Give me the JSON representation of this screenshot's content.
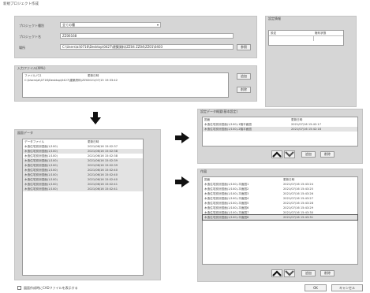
{
  "window": {
    "title": "新規プロジェクト作成"
  },
  "project": {
    "type_label": "プロジェクト種別",
    "type_value": "全ての種",
    "name_label": "プロジェクト名",
    "name_value": "ZZ06168",
    "folder_label": "場所",
    "folder_value": "C:\\Users\\ai\\0716\\Desktop\\0427\\建築資料\\ZZ04 ZZ04\\ZZ01\\0403",
    "browse_label": "参照"
  },
  "side_panel": {
    "title": "設定情報",
    "col1": "設定",
    "col2": "権利状態"
  },
  "input_file": {
    "title": "入力ファイル(XML)",
    "col1": "ファイルパス",
    "col2": "更新日時",
    "path": "C:\\Users\\ai\\0716\\Desktop\\0427\\建築資料\\ZZ04 ZZ04\\ZZ01\\0403",
    "date": "2021/07/15 19:33:42",
    "add_label": "追加",
    "delete_label": "削除"
  },
  "source_list": {
    "title": "図面データ",
    "col1": "データファイル",
    "col2": "更新日時",
    "rows": [
      {
        "name": "木造住宅設計図面(1/100)",
        "date": "2021/06/16 15:02:37"
      },
      {
        "name": "木造住宅設計図面(1/100)",
        "date": "2021/06/16 15:02:38"
      },
      {
        "name": "木造住宅設計図面(1/100)",
        "date": "2021/06/16 15:02:38"
      },
      {
        "name": "木造住宅設計図面(1/100)",
        "date": "2021/06/16 15:02:39"
      },
      {
        "name": "木造住宅設計図面(1/100)",
        "date": "2021/06/16 15:02:39"
      },
      {
        "name": "木造住宅設計図面(1/100)",
        "date": "2021/06/16 15:02:40"
      },
      {
        "name": "木造住宅設計図面(1/100)",
        "date": "2021/06/16 15:02:40"
      },
      {
        "name": "木造住宅設計図面(1/100)",
        "date": "2021/06/16 15:02:40"
      },
      {
        "name": "木造住宅設計図面(1/100)",
        "date": "2021/06/16 15:02:41"
      },
      {
        "name": "木造住宅設計図面(1/100)",
        "date": "2021/06/16 15:02:41"
      }
    ]
  },
  "target1": {
    "title": "設定データ概要(基本設定)",
    "col1": "図面",
    "col2": "更新日時",
    "rows": [
      {
        "name": "木造住宅設計図面(1/100)-1階平面図",
        "date": "2021/07/16 15:42:17"
      },
      {
        "name": "木造住宅設計図面(1/100)-2階平面図",
        "date": "2021/07/16 15:42:18"
      }
    ],
    "up_label": "上へ",
    "down_label": "下へ",
    "add_label": "追加",
    "delete_label": "削除"
  },
  "target2": {
    "title": "作図",
    "col1": "図面",
    "col2": "更新日時",
    "rows": [
      {
        "name": "木造住宅設計図面(1/100)-平面図1",
        "date": "2021/07/16 15:43:24"
      },
      {
        "name": "木造住宅設計図面(1/100)-平面図2",
        "date": "2021/07/16 15:43:25"
      },
      {
        "name": "木造住宅設計図面(1/100)-平面図3",
        "date": "2021/07/16 15:43:26"
      },
      {
        "name": "木造住宅設計図面(1/100)-平面図4",
        "date": "2021/07/16 15:43:27"
      },
      {
        "name": "木造住宅設計図面(1/100)-平面図5",
        "date": "2021/07/16 15:43:28"
      },
      {
        "name": "木造住宅設計図面(1/100)-平面図6",
        "date": "2021/07/16 15:43:29"
      },
      {
        "name": "木造住宅設計図面(1/100)-平面図7",
        "date": "2021/07/16 15:43:30"
      },
      {
        "name": "木造住宅設計図面(1/100)-平面図8",
        "date": "2021/07/16 15:43:31"
      }
    ],
    "up_label": "上へ",
    "down_label": "下へ",
    "add_label": "追加",
    "delete_label": "削除"
  },
  "footer": {
    "checkbox_label": "図面作成時にCADファイルを表示する",
    "ok_label": "OK",
    "cancel_label": "キャンセル"
  },
  "icons": {
    "arrow_down": "arrow-down-icon",
    "arrow_right": "arrow-right-icon",
    "chevron_up": "chevron-up-icon",
    "chevron_down": "chevron-down-icon"
  }
}
